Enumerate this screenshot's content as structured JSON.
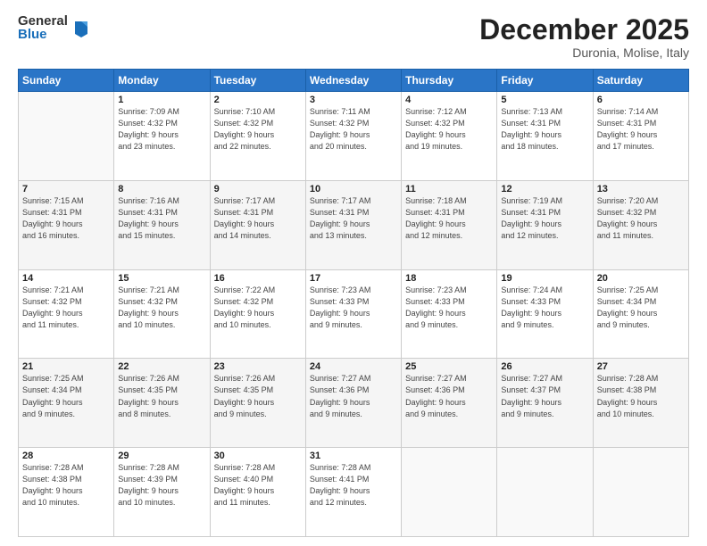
{
  "logo": {
    "general": "General",
    "blue": "Blue"
  },
  "title": "December 2025",
  "subtitle": "Duronia, Molise, Italy",
  "days_header": [
    "Sunday",
    "Monday",
    "Tuesday",
    "Wednesday",
    "Thursday",
    "Friday",
    "Saturday"
  ],
  "weeks": [
    [
      {
        "day": "",
        "detail": ""
      },
      {
        "day": "1",
        "detail": "Sunrise: 7:09 AM\nSunset: 4:32 PM\nDaylight: 9 hours\nand 23 minutes."
      },
      {
        "day": "2",
        "detail": "Sunrise: 7:10 AM\nSunset: 4:32 PM\nDaylight: 9 hours\nand 22 minutes."
      },
      {
        "day": "3",
        "detail": "Sunrise: 7:11 AM\nSunset: 4:32 PM\nDaylight: 9 hours\nand 20 minutes."
      },
      {
        "day": "4",
        "detail": "Sunrise: 7:12 AM\nSunset: 4:32 PM\nDaylight: 9 hours\nand 19 minutes."
      },
      {
        "day": "5",
        "detail": "Sunrise: 7:13 AM\nSunset: 4:31 PM\nDaylight: 9 hours\nand 18 minutes."
      },
      {
        "day": "6",
        "detail": "Sunrise: 7:14 AM\nSunset: 4:31 PM\nDaylight: 9 hours\nand 17 minutes."
      }
    ],
    [
      {
        "day": "7",
        "detail": "Sunrise: 7:15 AM\nSunset: 4:31 PM\nDaylight: 9 hours\nand 16 minutes."
      },
      {
        "day": "8",
        "detail": "Sunrise: 7:16 AM\nSunset: 4:31 PM\nDaylight: 9 hours\nand 15 minutes."
      },
      {
        "day": "9",
        "detail": "Sunrise: 7:17 AM\nSunset: 4:31 PM\nDaylight: 9 hours\nand 14 minutes."
      },
      {
        "day": "10",
        "detail": "Sunrise: 7:17 AM\nSunset: 4:31 PM\nDaylight: 9 hours\nand 13 minutes."
      },
      {
        "day": "11",
        "detail": "Sunrise: 7:18 AM\nSunset: 4:31 PM\nDaylight: 9 hours\nand 12 minutes."
      },
      {
        "day": "12",
        "detail": "Sunrise: 7:19 AM\nSunset: 4:31 PM\nDaylight: 9 hours\nand 12 minutes."
      },
      {
        "day": "13",
        "detail": "Sunrise: 7:20 AM\nSunset: 4:32 PM\nDaylight: 9 hours\nand 11 minutes."
      }
    ],
    [
      {
        "day": "14",
        "detail": "Sunrise: 7:21 AM\nSunset: 4:32 PM\nDaylight: 9 hours\nand 11 minutes."
      },
      {
        "day": "15",
        "detail": "Sunrise: 7:21 AM\nSunset: 4:32 PM\nDaylight: 9 hours\nand 10 minutes."
      },
      {
        "day": "16",
        "detail": "Sunrise: 7:22 AM\nSunset: 4:32 PM\nDaylight: 9 hours\nand 10 minutes."
      },
      {
        "day": "17",
        "detail": "Sunrise: 7:23 AM\nSunset: 4:33 PM\nDaylight: 9 hours\nand 9 minutes."
      },
      {
        "day": "18",
        "detail": "Sunrise: 7:23 AM\nSunset: 4:33 PM\nDaylight: 9 hours\nand 9 minutes."
      },
      {
        "day": "19",
        "detail": "Sunrise: 7:24 AM\nSunset: 4:33 PM\nDaylight: 9 hours\nand 9 minutes."
      },
      {
        "day": "20",
        "detail": "Sunrise: 7:25 AM\nSunset: 4:34 PM\nDaylight: 9 hours\nand 9 minutes."
      }
    ],
    [
      {
        "day": "21",
        "detail": "Sunrise: 7:25 AM\nSunset: 4:34 PM\nDaylight: 9 hours\nand 9 minutes."
      },
      {
        "day": "22",
        "detail": "Sunrise: 7:26 AM\nSunset: 4:35 PM\nDaylight: 9 hours\nand 8 minutes."
      },
      {
        "day": "23",
        "detail": "Sunrise: 7:26 AM\nSunset: 4:35 PM\nDaylight: 9 hours\nand 9 minutes."
      },
      {
        "day": "24",
        "detail": "Sunrise: 7:27 AM\nSunset: 4:36 PM\nDaylight: 9 hours\nand 9 minutes."
      },
      {
        "day": "25",
        "detail": "Sunrise: 7:27 AM\nSunset: 4:36 PM\nDaylight: 9 hours\nand 9 minutes."
      },
      {
        "day": "26",
        "detail": "Sunrise: 7:27 AM\nSunset: 4:37 PM\nDaylight: 9 hours\nand 9 minutes."
      },
      {
        "day": "27",
        "detail": "Sunrise: 7:28 AM\nSunset: 4:38 PM\nDaylight: 9 hours\nand 10 minutes."
      }
    ],
    [
      {
        "day": "28",
        "detail": "Sunrise: 7:28 AM\nSunset: 4:38 PM\nDaylight: 9 hours\nand 10 minutes."
      },
      {
        "day": "29",
        "detail": "Sunrise: 7:28 AM\nSunset: 4:39 PM\nDaylight: 9 hours\nand 10 minutes."
      },
      {
        "day": "30",
        "detail": "Sunrise: 7:28 AM\nSunset: 4:40 PM\nDaylight: 9 hours\nand 11 minutes."
      },
      {
        "day": "31",
        "detail": "Sunrise: 7:28 AM\nSunset: 4:41 PM\nDaylight: 9 hours\nand 12 minutes."
      },
      {
        "day": "",
        "detail": ""
      },
      {
        "day": "",
        "detail": ""
      },
      {
        "day": "",
        "detail": ""
      }
    ]
  ]
}
